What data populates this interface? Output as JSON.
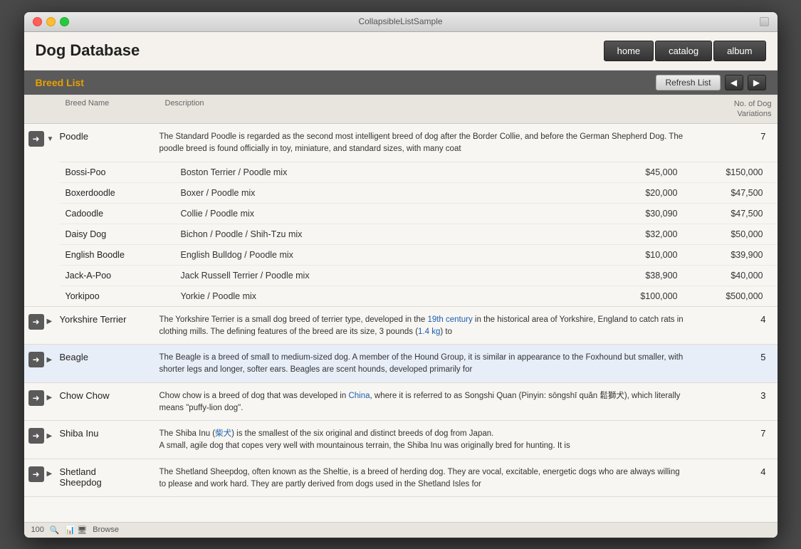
{
  "window": {
    "title": "CollapsibleListSample"
  },
  "header": {
    "app_title": "Dog Database",
    "nav": {
      "home": "home",
      "catalog": "catalog",
      "album": "album"
    }
  },
  "section": {
    "title": "Breed List",
    "refresh_label": "Refresh List"
  },
  "table": {
    "columns": {
      "breed_name": "Breed Name",
      "description": "Description",
      "no_of_variations": "No. of Dog\nVariations"
    },
    "breeds": [
      {
        "id": "poodle",
        "name": "Poodle",
        "description": "The Standard Poodle is regarded as the second most intelligent breed of dog after the Border Collie, and before the German Shepherd Dog. The poodle breed is found officially in toy, miniature, and standard sizes, with many coat",
        "count": "7",
        "expanded": true,
        "highlighted": false,
        "variations": [
          {
            "name": "Bossi-Poo",
            "desc": "Boston Terrier / Poodle mix",
            "low": "$45,000",
            "high": "$150,000"
          },
          {
            "name": "Boxerdoodle",
            "desc": "Boxer / Poodle mix",
            "low": "$20,000",
            "high": "$47,500"
          },
          {
            "name": "Cadoodle",
            "desc": "Collie / Poodle mix",
            "low": "$30,090",
            "high": "$47,500"
          },
          {
            "name": "Daisy Dog",
            "desc": "Bichon  /  Poodle / Shih-Tzu mix",
            "low": "$32,000",
            "high": "$50,000"
          },
          {
            "name": "English Boodle",
            "desc": "English Bulldog / Poodle mix",
            "low": "$10,000",
            "high": "$39,900"
          },
          {
            "name": "Jack-A-Poo",
            "desc": "Jack Russell Terrier / Poodle mix",
            "low": "$38,900",
            "high": "$40,000"
          },
          {
            "name": "Yorkipoo",
            "desc": "Yorkie / Poodle mix",
            "low": "$100,000",
            "high": "$500,000"
          }
        ]
      },
      {
        "id": "yorkshire",
        "name": "Yorkshire Terrier",
        "description": "The Yorkshire Terrier is a small dog breed of terrier type, developed in the 19th century in the historical area of Yorkshire, England to catch rats in clothing mills. The defining features of the breed are its size, 3 pounds (1.4 kg) to",
        "count": "4",
        "expanded": false,
        "highlighted": false
      },
      {
        "id": "beagle",
        "name": "Beagle",
        "description": "The Beagle is a breed of small to medium-sized dog. A member of the Hound Group, it is similar in appearance to the Foxhound but smaller, with shorter legs and longer, softer ears. Beagles are scent hounds, developed primarily for",
        "count": "5",
        "expanded": false,
        "highlighted": true
      },
      {
        "id": "chow-chow",
        "name": "Chow Chow",
        "description": "Chow chow is a breed of dog that was developed in China, where it is referred to as Songshi Quan (Pinyin: sōngshī quǎn 鬆獅犬), which literally means \"puffy-lion dog\".",
        "count": "3",
        "expanded": false,
        "highlighted": false
      },
      {
        "id": "shiba-inu",
        "name": "Shiba Inu",
        "description": "The Shiba Inu (柴犬) is the smallest of the six original and distinct breeds of dog from Japan.\nA small, agile dog that copes very well with mountainous terrain, the Shiba Inu was originally bred for hunting. It is",
        "count": "7",
        "expanded": false,
        "highlighted": false
      },
      {
        "id": "shetland",
        "name": "Shetland Sheepdog",
        "description": "The Shetland Sheepdog, often known as the Sheltie, is a breed of herding dog. They are vocal, excitable, energetic dogs who are always willing to please and work hard. They are partly derived from dogs used in the Shetland Isles for",
        "count": "4",
        "expanded": false,
        "highlighted": false
      }
    ]
  },
  "status_bar": {
    "zoom": "100",
    "mode": "Browse"
  }
}
